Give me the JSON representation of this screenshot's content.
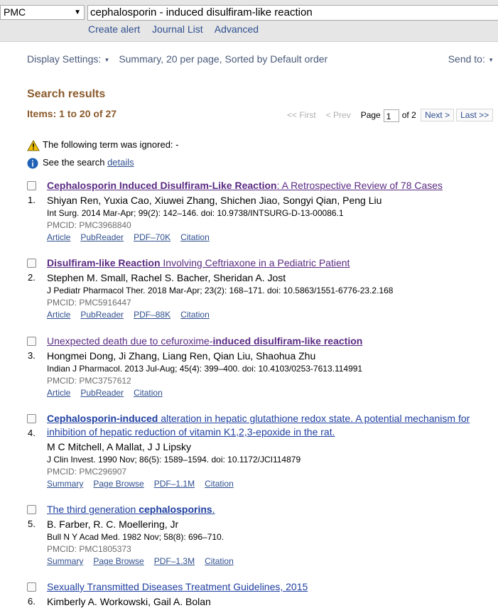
{
  "header": {
    "database": "PMC",
    "query": "cephalosporin - induced disulfiram-like reaction",
    "links": [
      "Create alert",
      "Journal List",
      "Advanced"
    ]
  },
  "display": {
    "settings_label": "Display Settings:",
    "summary": "Summary, 20 per page, Sorted by Default order",
    "send_to": "Send to:"
  },
  "results_title": "Search results",
  "items_count": "Items: 1 to 20 of 27",
  "pager": {
    "first": "<< First",
    "prev": "< Prev",
    "page_label": "Page",
    "page_value": "1",
    "of_label": "of 2",
    "next": "Next >",
    "last": "Last >>"
  },
  "messages": {
    "ignored": "The following term was ignored: -",
    "see_prefix": "See the search ",
    "see_link": "details",
    "see_suffix": "."
  },
  "results": [
    {
      "num": "1.",
      "title_parts": [
        {
          "t": "Cephalosporin Induced Disulfiram-Like Reaction",
          "b": true
        },
        {
          "t": ": A Retrospective Review of 78 Cases",
          "b": false
        }
      ],
      "authors": "Shiyan Ren, Yuxia Cao, Xiuwei Zhang, Shichen Jiao, Songyi Qian, Peng Liu",
      "citation": "Int Surg. 2014 Mar-Apr; 99(2): 142–146. doi: 10.9738/INTSURG-D-13-00086.1",
      "pmcid": "PMCID: PMC3968840",
      "links": [
        "Article",
        "PubReader",
        "PDF–70K",
        "Citation"
      ]
    },
    {
      "num": "2.",
      "title_parts": [
        {
          "t": "Disulfiram-like Reaction",
          "b": true
        },
        {
          "t": " Involving Ceftriaxone in a Pediatric Patient",
          "b": false
        }
      ],
      "authors": "Stephen M. Small, Rachel S. Bacher, Sheridan A. Jost",
      "citation": "J Pediatr Pharmacol Ther. 2018 Mar-Apr; 23(2): 168–171. doi: 10.5863/1551-6776-23.2.168",
      "pmcid": "PMCID: PMC5916447",
      "links": [
        "Article",
        "PubReader",
        "PDF–88K",
        "Citation"
      ]
    },
    {
      "num": "3.",
      "title_parts": [
        {
          "t": "Unexpected death due to cefuroxime-",
          "b": false
        },
        {
          "t": "induced disulfiram-like reaction",
          "b": true
        }
      ],
      "authors": "Hongmei Dong, Ji Zhang, Liang Ren, Qian Liu, Shaohua Zhu",
      "citation": "Indian J Pharmacol. 2013 Jul-Aug; 45(4): 399–400. doi: 10.4103/0253-7613.114991",
      "pmcid": "PMCID: PMC3757612",
      "links": [
        "Article",
        "PubReader",
        "Citation"
      ]
    },
    {
      "num": "4.",
      "title_parts": [
        {
          "t": "Cephalosporin-induced",
          "b": true
        },
        {
          "t": " alteration in hepatic glutathione redox state. A potential mechanism for inhibition of hepatic reduction of vitamin K1,2,3-epoxide in the rat.",
          "b": false
        }
      ],
      "authors": "M C Mitchell, A Mallat, J J Lipsky",
      "citation": "J Clin Invest. 1990 Nov; 86(5): 1589–1594. doi: 10.1172/JCI114879",
      "pmcid": "PMCID: PMC296907",
      "links": [
        "Summary",
        "Page Browse",
        "PDF–1.1M",
        "Citation"
      ]
    },
    {
      "num": "5.",
      "title_parts": [
        {
          "t": "The third generation ",
          "b": false
        },
        {
          "t": "cephalosporins",
          "b": true
        },
        {
          "t": ".",
          "b": false
        }
      ],
      "authors": "B. Farber, R. C. Moellering, Jr",
      "citation": "Bull N Y Acad Med. 1982 Nov; 58(8): 696–710.",
      "pmcid": "PMCID: PMC1805373",
      "links": [
        "Summary",
        "Page Browse",
        "PDF–1.3M",
        "Citation"
      ]
    },
    {
      "num": "6.",
      "title_parts": [
        {
          "t": "Sexually Transmitted Diseases Treatment Guidelines, 2015",
          "b": false
        }
      ],
      "authors": "Kimberly A. Workowski, Gail A. Bolan",
      "citation": "",
      "pmcid": "",
      "links": []
    }
  ]
}
